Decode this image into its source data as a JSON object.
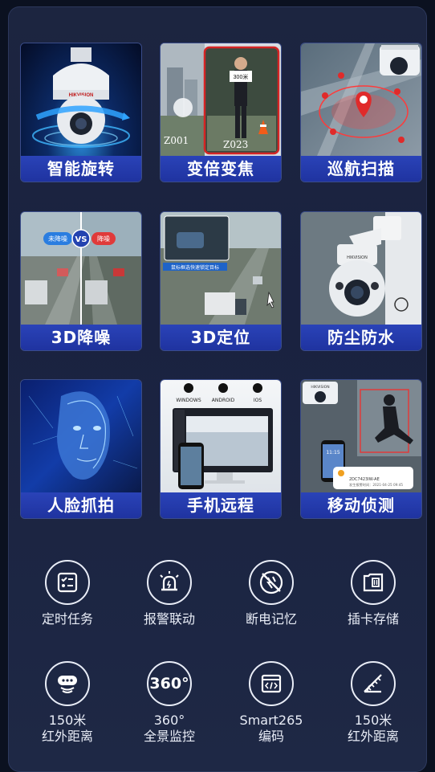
{
  "tiles": [
    {
      "label": "智能旋转",
      "icon": "ptz-camera-rotation-image"
    },
    {
      "label": "变倍变焦",
      "icon": "zoom-comparison-image"
    },
    {
      "label": "巡航扫描",
      "icon": "patrol-map-image"
    },
    {
      "label": "3D降噪",
      "icon": "noise-reduction-image"
    },
    {
      "label": "3D定位",
      "icon": "highway-positioning-image"
    },
    {
      "label": "防尘防水",
      "icon": "waterproof-camera-image"
    },
    {
      "label": "人脸抓拍",
      "icon": "face-capture-image"
    },
    {
      "label": "手机远程",
      "icon": "mobile-remote-image"
    },
    {
      "label": "移动侦测",
      "icon": "motion-detection-image"
    }
  ],
  "tile_text": {
    "z001": "Z001",
    "z023": "Z023",
    "zoom_sign": "300米",
    "noise_before": "未降噪",
    "vs": "VS",
    "noise_after": "降噪",
    "locate_hint": "鼠标框选快速锁定目标",
    "os_windows": "WINDOWS",
    "os_android": "ANDROID",
    "os_ios": "IOS",
    "phone_time": "11:15",
    "alert_device": "2DC7423IW-AE",
    "alert_time": "发生报警时间：2021-04-25 09:45",
    "brand": "HIKVISION"
  },
  "features": [
    {
      "label": "定时任务",
      "icon": "checklist-icon"
    },
    {
      "label": "报警联动",
      "icon": "alarm-light-icon"
    },
    {
      "label": "断电记忆",
      "icon": "power-memory-icon"
    },
    {
      "label": "插卡存储",
      "icon": "sd-card-icon"
    },
    {
      "label": "150米\n红外距离",
      "icon": "infrared-camera-icon"
    },
    {
      "label": "360°\n全景监控",
      "icon": "panorama-360-icon",
      "icon_text": "360°"
    },
    {
      "label": "Smart265\n编码",
      "icon": "code-window-icon"
    },
    {
      "label": "150米\n红外距离",
      "icon": "infrared-range-icon"
    }
  ],
  "colors": {
    "caption_bg": "#2139b0",
    "panel_bg": "#1c2540",
    "alert_red": "#e03a3a"
  }
}
